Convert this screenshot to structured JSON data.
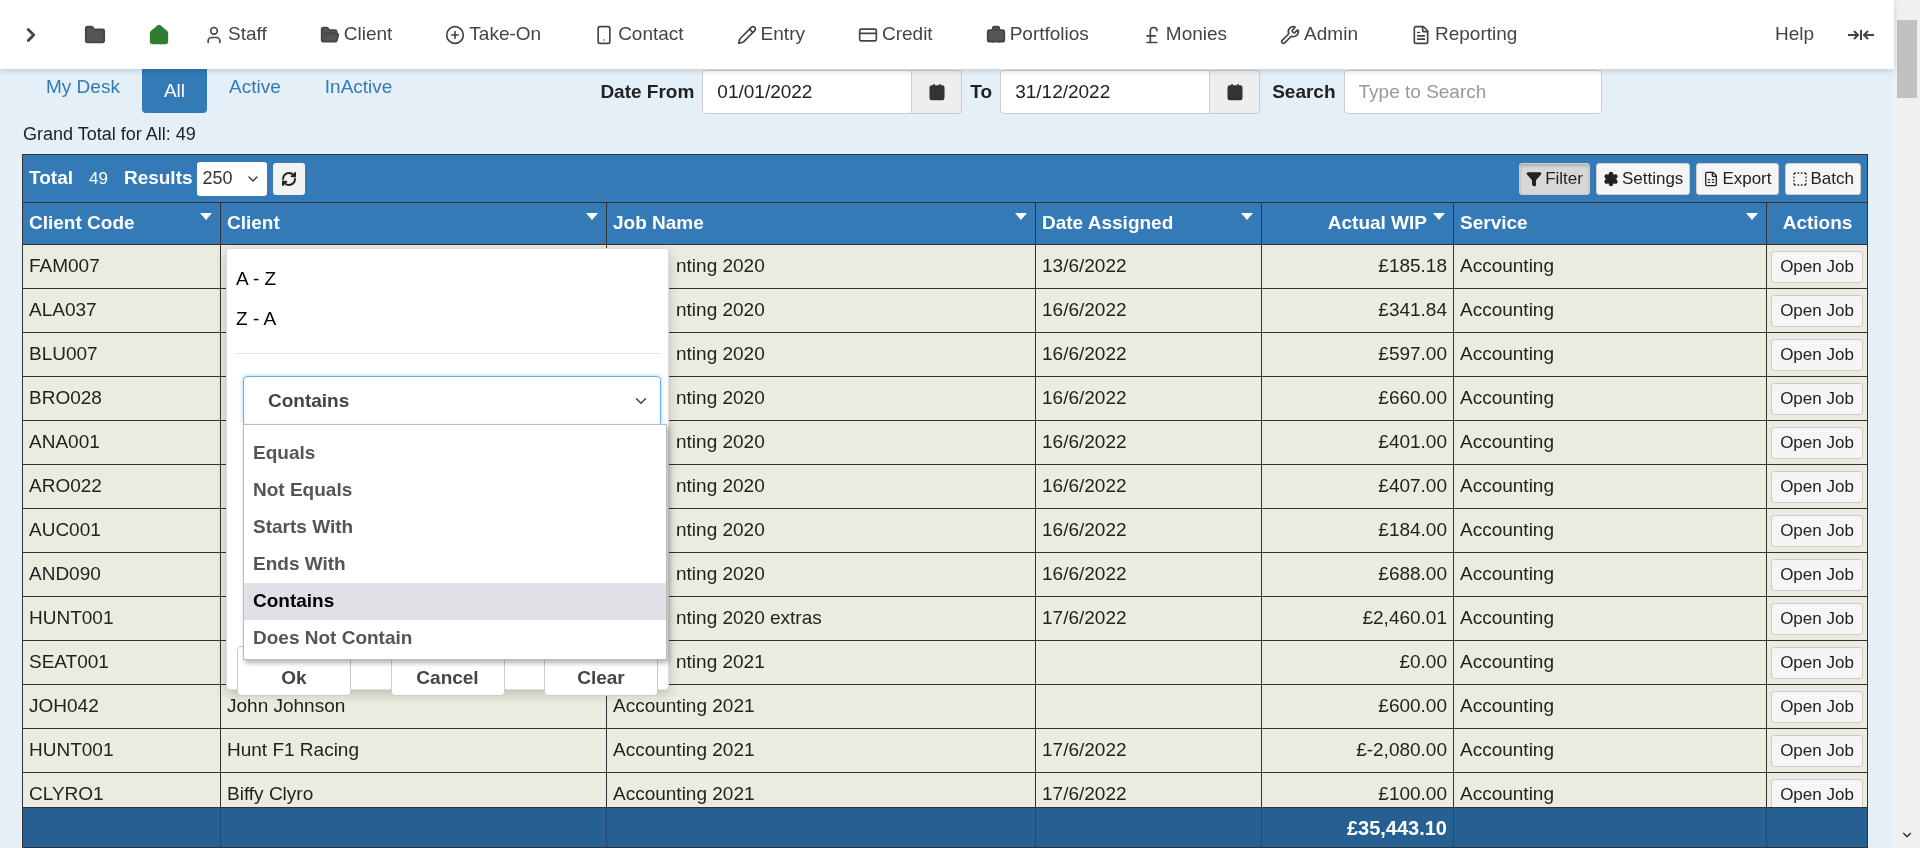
{
  "nav": {
    "items": [
      "Staff",
      "Client",
      "Take-On",
      "Contact",
      "Entry",
      "Credit",
      "Portfolios",
      "Monies",
      "Admin",
      "Reporting"
    ],
    "help": "Help"
  },
  "tabs": [
    {
      "label": "My Desk",
      "selected": false
    },
    {
      "label": "All",
      "selected": true
    },
    {
      "label": "Active",
      "selected": false
    },
    {
      "label": "InActive",
      "selected": false
    }
  ],
  "date_filter": {
    "from_label": "Date From",
    "from_value": "01/01/2022",
    "to_label": "To",
    "to_value": "31/12/2022",
    "search_label": "Search",
    "search_placeholder": "Type to Search"
  },
  "grand_total": "Grand Total for All: 49",
  "toolbar": {
    "total_label": "Total",
    "total": "49",
    "results_label": "Results",
    "results_value": "250",
    "buttons": [
      {
        "label": "Filter",
        "active": true
      },
      {
        "label": "Settings",
        "active": false
      },
      {
        "label": "Export",
        "active": false
      },
      {
        "label": "Batch",
        "active": false
      }
    ]
  },
  "columns": [
    {
      "label": "Client Code",
      "menu": true
    },
    {
      "label": "Client",
      "menu": true
    },
    {
      "label": "Job Name",
      "menu": true
    },
    {
      "label": "Date Assigned",
      "menu": true
    },
    {
      "label": "Actual WIP",
      "menu": true
    },
    {
      "label": "Service",
      "menu": true
    },
    {
      "label": "Actions",
      "menu": false
    }
  ],
  "rows": [
    {
      "client_code": "FAM007",
      "job_name": "nting 2020",
      "date_assigned": "13/6/2022",
      "actual_wip": "£185.18",
      "service": "Accounting",
      "action": "Open Job"
    },
    {
      "client_code": "ALA037",
      "job_name": "nting 2020",
      "date_assigned": "16/6/2022",
      "actual_wip": "£341.84",
      "service": "Accounting",
      "action": "Open Job"
    },
    {
      "client_code": "BLU007",
      "job_name": "nting 2020",
      "date_assigned": "16/6/2022",
      "actual_wip": "£597.00",
      "service": "Accounting",
      "action": "Open Job"
    },
    {
      "client_code": "BRO028",
      "job_name": "nting 2020",
      "date_assigned": "16/6/2022",
      "actual_wip": "£660.00",
      "service": "Accounting",
      "action": "Open Job"
    },
    {
      "client_code": "ANA001",
      "job_name": "nting 2020",
      "date_assigned": "16/6/2022",
      "actual_wip": "£401.00",
      "service": "Accounting",
      "action": "Open Job"
    },
    {
      "client_code": "ARO022",
      "job_name": "nting 2020",
      "date_assigned": "16/6/2022",
      "actual_wip": "£407.00",
      "service": "Accounting",
      "action": "Open Job"
    },
    {
      "client_code": "AUC001",
      "job_name": "nting 2020",
      "date_assigned": "16/6/2022",
      "actual_wip": "£184.00",
      "service": "Accounting",
      "action": "Open Job"
    },
    {
      "client_code": "AND090",
      "job_name": "nting 2020",
      "date_assigned": "16/6/2022",
      "actual_wip": "£688.00",
      "service": "Accounting",
      "action": "Open Job"
    },
    {
      "client_code": "HUNT001",
      "job_name": "nting 2020 extras",
      "date_assigned": "17/6/2022",
      "actual_wip": "£2,460.01",
      "service": "Accounting",
      "action": "Open Job"
    },
    {
      "client_code": "SEAT001",
      "job_name": "nting 2021",
      "actual_wip": "£0.00",
      "service": "Accounting",
      "action": "Open Job"
    },
    {
      "client_code": "JOH042",
      "client": "John Johnson",
      "job_name": "Accounting 2021",
      "actual_wip": "£600.00",
      "service": "Accounting",
      "action": "Open Job"
    },
    {
      "client_code": "HUNT001",
      "client": "Hunt F1 Racing",
      "job_name": "Accounting 2021",
      "date_assigned": "17/6/2022",
      "actual_wip": "£-2,080.00",
      "service": "Accounting",
      "action": "Open Job"
    },
    {
      "client_code": "CLYRO1",
      "client": "Biffy Clyro",
      "job_name": "Accounting 2021",
      "date_assigned": "17/6/2022",
      "actual_wip": "£100.00",
      "service": "Accounting",
      "action": "Open Job"
    }
  ],
  "footer": {
    "actual_wip": "£35,443.10"
  },
  "filter_popup": {
    "sort_options": [
      "A - Z",
      "Z - A"
    ],
    "operator": "Contains",
    "options": [
      {
        "label": "Equals",
        "selected": false
      },
      {
        "label": "Not Equals",
        "selected": false
      },
      {
        "label": "Starts With",
        "selected": false
      },
      {
        "label": "Ends With",
        "selected": false
      },
      {
        "label": "Contains",
        "selected": true
      },
      {
        "label": "Does Not Contain",
        "selected": false
      }
    ],
    "buttons": [
      "Ok",
      "Cancel",
      "Clear"
    ]
  }
}
